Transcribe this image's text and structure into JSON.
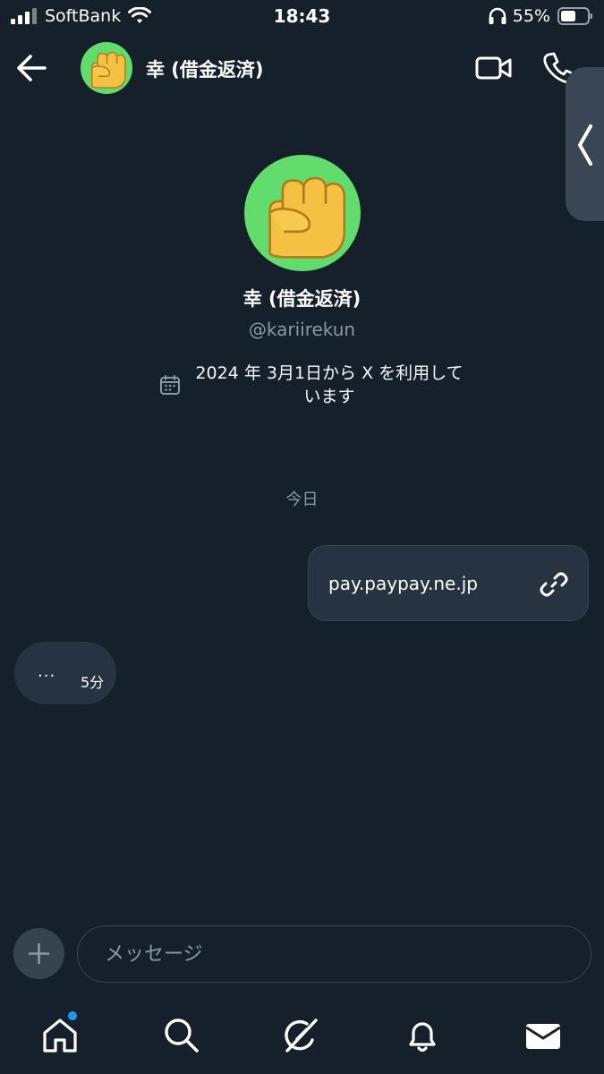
{
  "status_bar": {
    "carrier": "SoftBank",
    "time": "18:43",
    "battery": "55%"
  },
  "header": {
    "name": "幸 (借金返済)",
    "avatar": "raised-fist-emoji"
  },
  "profile": {
    "name": "幸 (借金返済)",
    "handle": "@kariirekun",
    "joined": "2024 年 3月1日から X を利用して\nいます"
  },
  "date_separator": "今日",
  "messages": [
    {
      "direction": "outgoing",
      "text": "pay.paypay.ne.jp",
      "icon": "link-icon"
    }
  ],
  "typing": {
    "dots": "···",
    "time": "5分"
  },
  "composer": {
    "placeholder": "メッセージ"
  },
  "tabbar": {
    "items": [
      "home-icon",
      "search-icon",
      "grok-icon",
      "bell-icon",
      "envelope-icon"
    ],
    "active": "envelope-icon"
  },
  "colors": {
    "background": "#15202b",
    "bubble": "#273340",
    "border": "#38444d",
    "secondary_text": "#8b98a5",
    "accent": "#1d9bf0",
    "avatar_bg": "#63dc6e"
  }
}
